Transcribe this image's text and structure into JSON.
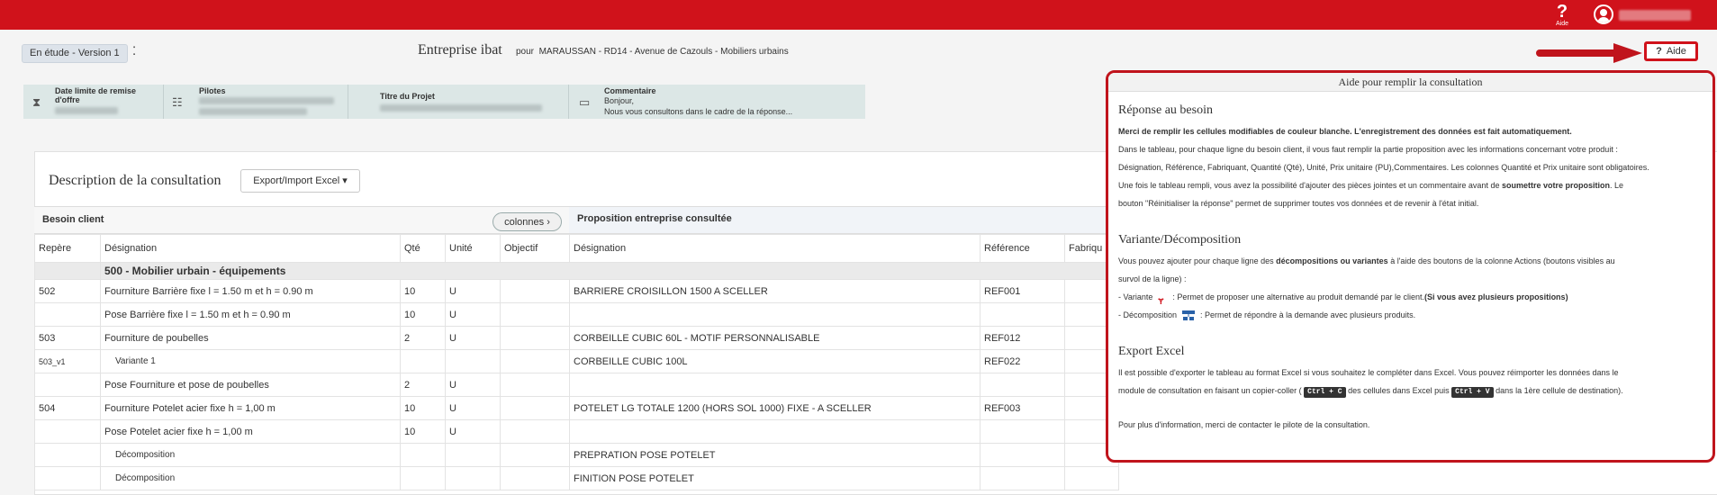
{
  "topbar": {
    "help_label": "Aide",
    "help_icon": "question-icon",
    "user_icon": "user-avatar-icon"
  },
  "header": {
    "status": "En étude - Version 1",
    "title": "Entreprise ibat",
    "for_label": "pour",
    "location": "MARAUSSAN - RD14 - Avenue de Cazouls - Mobiliers urbains"
  },
  "info": {
    "deadline_label": "Date limite de remise d'offre",
    "pilots_label": "Pilotes",
    "project_title_label": "Titre du Projet",
    "comment_label": "Commentaire",
    "comment_line1": "Bonjour,",
    "comment_line2": "Nous vous consultons dans le cadre de la réponse..."
  },
  "aide_button": "Aide",
  "consultation": {
    "title": "Description de la consultation",
    "export_btn": "Export/Import Excel ▾",
    "group_client": "Besoin client",
    "group_company": "Proposition entreprise consultée",
    "columns_btn": "colonnes ›",
    "headers": [
      "Repère",
      "Désignation",
      "Qté",
      "Unité",
      "Objectif",
      "Désignation",
      "Référence",
      "Fabriqu"
    ],
    "section": "500 - Mobilier urbain - équipements",
    "rows": [
      [
        "502",
        "Fourniture Barrière fixe l = 1.50 m et h = 0.90 m",
        "10",
        "U",
        "",
        "BARRIERE CROISILLON 1500 A SCELLER",
        "REF001",
        ""
      ],
      [
        "",
        "Pose Barrière fixe l = 1.50 m et h = 0.90 m",
        "10",
        "U",
        "",
        "",
        "",
        ""
      ],
      [
        "503",
        "Fourniture de poubelles",
        "2",
        "U",
        "",
        "CORBEILLE CUBIC 60L - MOTIF PERSONNALISABLE",
        "REF012",
        ""
      ],
      [
        "503_v1",
        "Variante 1",
        "",
        "",
        "",
        "CORBEILLE CUBIC 100L",
        "REF022",
        ""
      ],
      [
        "",
        "Pose Fourniture et pose de poubelles",
        "2",
        "U",
        "",
        "",
        "",
        ""
      ],
      [
        "504",
        "Fourniture Potelet acier fixe h = 1,00 m",
        "10",
        "U",
        "",
        "POTELET LG TOTALE 1200 (HORS SOL 1000) FIXE - A SCELLER",
        "REF003",
        ""
      ],
      [
        "",
        "Pose Potelet acier fixe h = 1,00 m",
        "10",
        "U",
        "",
        "",
        "",
        ""
      ],
      [
        "",
        "Décomposition",
        "",
        "",
        "",
        "PREPRATION POSE POTELET",
        "",
        ""
      ],
      [
        "",
        "Décomposition",
        "",
        "",
        "",
        "FINITION POSE POTELET",
        "",
        ""
      ]
    ]
  },
  "help_panel": {
    "title": "Aide pour remplir la consultation",
    "s1_title": "Réponse au besoin",
    "s1_bold": "Merci de remplir les cellules modifiables de couleur blanche. L'enregistrement des données est fait automatiquement.",
    "s1_p1": "Dans le tableau, pour chaque ligne du besoin client, il vous faut remplir la partie proposition avec les informations concernant votre produit :",
    "s1_p2": "Désignation, Référence, Fabriquant, Quantité (Qté), Unité, Prix unitaire (PU),Commentaires. Les colonnes Quantité et Prix unitaire sont obligatoires.",
    "s1_p3a": "Une fois le tableau rempli, vous avez la possibilité d'ajouter des pièces jointes et un commentaire avant de",
    "s1_p3b": "soumettre votre proposition",
    "s1_p3c": ". Le",
    "s1_p4": "bouton \"Réinitialiser la réponse\" permet de supprimer toutes vos données et de revenir à l'état initial.",
    "s2_title": "Variante/Décomposition",
    "s2_p1a": "Vous pouvez ajouter pour chaque ligne des",
    "s2_p1b": "décompositions ou variantes",
    "s2_p1c": "à l'aide des boutons de la colonne Actions (boutons visibles au",
    "s2_p2": "survol de la ligne) :",
    "s2_var_label": "- Variante",
    "s2_var_text": ": Permet de proposer une alternative au produit demandé par le client.",
    "s2_var_bold": "(Si vous avez plusieurs propositions)",
    "s2_dec_label": "- Décomposition",
    "s2_dec_text": ": Permet de répondre à la demande avec plusieurs produits.",
    "s3_title": "Export Excel",
    "s3_p1": "Il est possible d'exporter le tableau au format Excel si vous souhaitez le compléter dans Excel. Vous pouvez réimporter les données dans le",
    "s3_p2a": "module de consultation en faisant un copier-coller (",
    "s3_k1": "Ctrl + C",
    "s3_p2b": "des cellules dans Excel puis",
    "s3_k2": "Ctrl + V",
    "s3_p2c": "dans la 1ère cellule de destination).",
    "footer": "Pour plus d'information, merci de contacter le pilote de la consultation."
  }
}
